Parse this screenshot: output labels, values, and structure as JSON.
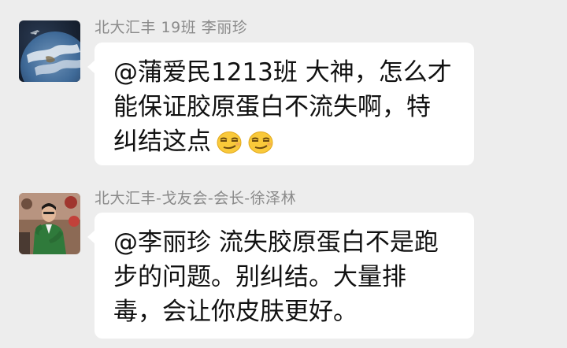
{
  "messages": [
    {
      "sender": "北大汇丰 19班 李丽珍",
      "avatar_icon": "earth-from-space-avatar",
      "lines": [
        "@蒲爱民1213班 大神，怎么才",
        "能保证胶原蛋白不流失啊，特",
        "纠结这点"
      ],
      "emoji_icon": "smirk-face-emoji",
      "emoji_count": 2
    },
    {
      "sender": "北大汇丰-戈友会-会长-徐泽林",
      "avatar_icon": "man-in-green-jacket-avatar",
      "lines": [
        "@李丽珍 流失胶原蛋白不是跑",
        "步的问题。别纠结。大量排",
        "毒，会让你皮肤更好。"
      ]
    }
  ],
  "colors": {
    "background": "#ededed",
    "bubble": "#ffffff",
    "sender_text": "#8a8a8a",
    "message_text": "#111111"
  }
}
